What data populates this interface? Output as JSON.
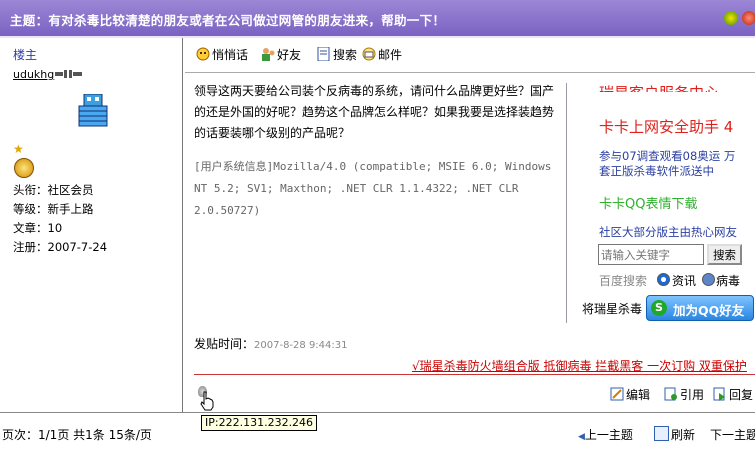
{
  "topic": {
    "title": "主题：有对杀毒比较清楚的朋友或者在公司做过网管的朋友进来，帮助一下！"
  },
  "author": {
    "floor": "楼主",
    "username": "udukhg",
    "stats": [
      {
        "label": "头衔",
        "value": "社区会员"
      },
      {
        "label": "等级",
        "value": "新手上路"
      },
      {
        "label": "文章",
        "value": "10"
      },
      {
        "label": "注册",
        "value": "2007-7-24"
      }
    ]
  },
  "toolbar": {
    "items": [
      "悄悄话",
      "好友",
      "搜索",
      "邮件"
    ]
  },
  "post": {
    "body": "领导这两天要给公司装个反病毒的系统，请问什么品牌更好些？国产的还是外国的好呢？趋势这个品牌怎么样呢？如果我要是选择装趋势的话要装哪个级别的产品呢？",
    "user_info": "[用户系统信息]Mozilla/4.0 (compatible; MSIE 6.0; Windows NT 5.2; SV1; Maxthon; .NET CLR 1.1.4322; .NET CLR 2.0.50727)",
    "date_label": "发贴时间：",
    "date_value": "2007-8-28 9:44:31",
    "signature": "√瑞星杀毒防火墙组合版 抵御病毒 拦截黑客 一次订购 双重保护"
  },
  "ad": {
    "line1": "瑞星客户服务中心",
    "line2": "卡卡上网安全助手 4",
    "line3a": "参与07调查观看08奥运 万",
    "line3b": "套正版杀毒软件派送中",
    "line4": "卡卡QQ表情下载",
    "line5": "社区大部分版主由热心网友",
    "search_placeholder": "请输入关键字",
    "search_button": "搜索",
    "baidu": "百度搜索",
    "radio1": "资讯",
    "radio2": "病毒",
    "qq_label": "将瑞星杀毒",
    "qq_button": "加为QQ好友"
  },
  "actions": {
    "edit": "编辑",
    "quote": "引用",
    "reply": "回复"
  },
  "tooltip": {
    "ip": "IP:222.131.232.246"
  },
  "footer": {
    "pageinfo": "页次：1/1页 共1条 15条/页",
    "prev": "上一主题",
    "refresh": "刷新",
    "next": "下一主题"
  },
  "colors": {
    "title_bar": "#8b74cc",
    "link_blue": "#2b3fa3",
    "ad_red": "#e0201a",
    "ad_green": "#2fb02f",
    "signature_red": "#cc0000"
  }
}
